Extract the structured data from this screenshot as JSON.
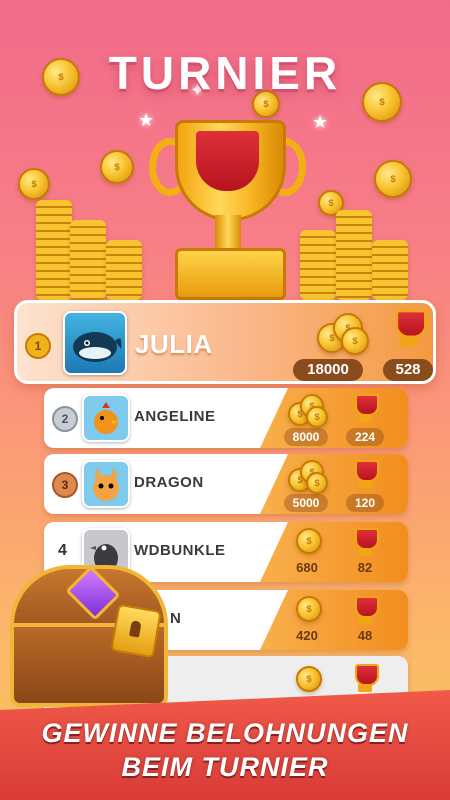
{
  "header": {
    "title": "TURNIER"
  },
  "leaderboard": [
    {
      "rank": "1",
      "name": "JULIA",
      "coins": "18000",
      "trophies": "528"
    },
    {
      "rank": "2",
      "name": "ANGELINE",
      "coins": "8000",
      "trophies": "224"
    },
    {
      "rank": "3",
      "name": "DRAGON",
      "coins": "5000",
      "trophies": "120"
    },
    {
      "rank": "4",
      "name": "WDBUNKLE",
      "coins": "680",
      "trophies": "82"
    },
    {
      "rank": "",
      "name": "N",
      "coins": "420",
      "trophies": "48"
    },
    {
      "rank": "",
      "name": "",
      "coins": "",
      "trophies": ""
    }
  ],
  "banner": {
    "line1": "GEWINNE BELOHNUNGEN",
    "line2": "BEIM TURNIER"
  },
  "colors": {
    "gold": "#f8c531",
    "row_stripe": "#f28d1e",
    "banner_red": "#d93b37",
    "bg_top": "#f26b8b",
    "bg_bottom": "#f7c45a"
  },
  "icons": {
    "medal_1": "gold-medal-icon",
    "medal_2": "silver-medal-icon",
    "medal_3": "bronze-medal-icon",
    "coins": "coin-stack-icon",
    "trophy": "trophy-icon",
    "chest": "treasure-chest-icon"
  }
}
